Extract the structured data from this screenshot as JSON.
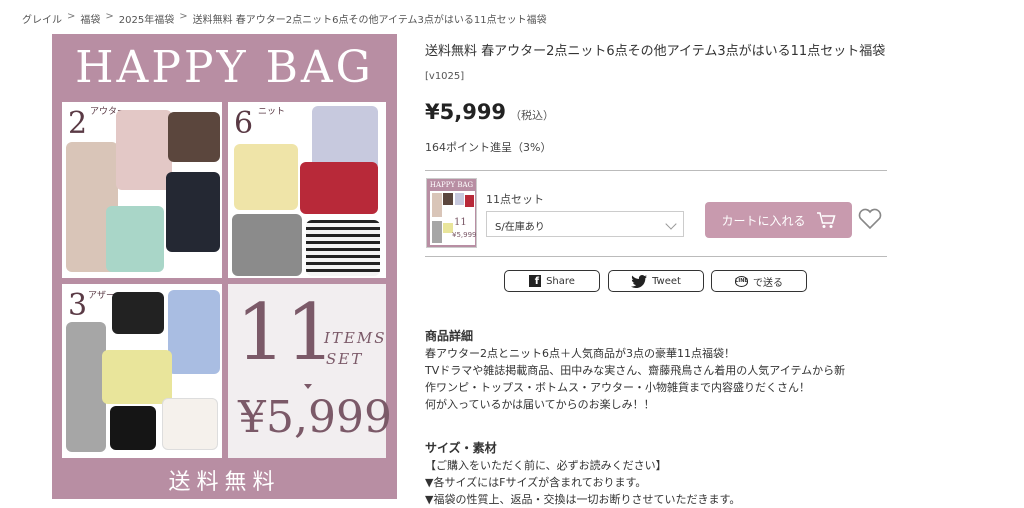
{
  "breadcrumb": [
    "グレイル",
    "福袋",
    "2025年福袋",
    "送料無料 春アウター2点ニット6点その他アイテム3点がはいる11点セット福袋"
  ],
  "hero": {
    "title": "HAPPY BAG",
    "panel1_num": "2",
    "panel1_tag": "アウター",
    "panel2_num": "6",
    "panel2_tag": "ニット",
    "panel3_num": "3",
    "panel3_tag": "アザー",
    "count": "11",
    "items_line1": "ITEMS",
    "items_line2": "SET",
    "price": "¥5,999",
    "shipping": "送料無料",
    "colors": {
      "background": "#b88ea3",
      "accent": "#7b5968"
    }
  },
  "product": {
    "title": "送料無料 春アウター2点ニット6点その他アイテム3点がはいる11点セット福袋",
    "code": "[v1025]",
    "price": "¥5,999",
    "tax_note": "（税込）",
    "points": "164ポイント進呈（3%）",
    "set_label": "11点セット",
    "variant_select": "S/在庫あり",
    "cart_button": "カートに入れる",
    "cart_color": "#c89aae"
  },
  "thumb": {
    "title": "HAPPY BAG",
    "count": "11",
    "price": "¥5,999"
  },
  "share": {
    "facebook": "Share",
    "twitter": "Tweet",
    "line": "で送る"
  },
  "details": {
    "heading": "商品詳細",
    "lines": [
      "春アウター2点とニット6点＋人気商品が3点の豪華11点福袋！",
      "TVドラマや雑誌掲載商品、田中みな実さん、齋藤飛鳥さん着用の人気アイテムから新",
      "作ワンピ・トップス・ボトムス・アウター・小物雑貨まで内容盛りだくさん！",
      "何が入っているかは届いてからのお楽しみ！！"
    ]
  },
  "size": {
    "heading": "サイズ・素材",
    "lines": [
      "【ご購入をいただく前に、必ずお読みください】",
      "▼各サイズにはFサイズが含まれております。",
      "▼福袋の性質上、返品・交換は一切お断りさせていただきます。"
    ]
  }
}
